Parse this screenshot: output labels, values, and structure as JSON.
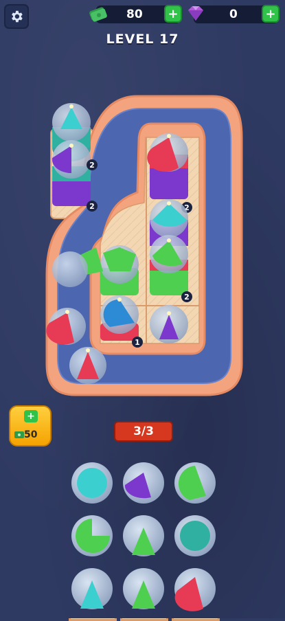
{
  "hud": {
    "cash": "80",
    "gems": "0",
    "add_symbol": "+",
    "level_label": "LEVEL 17"
  },
  "progress": {
    "label": "3/3"
  },
  "bonus": {
    "amount": "50",
    "add_symbol": "+"
  },
  "stack_counts": [
    "2",
    "2",
    "2",
    "2",
    "1"
  ],
  "colors": {
    "background": "#2f3a63",
    "track_inner": "#4d66b0",
    "track_border": "#f0a07a",
    "tray": "#f3d7b3",
    "cyan": "#3ccfd0",
    "purple": "#7c37cc",
    "red": "#e63a55",
    "green": "#4fcf4f",
    "teal": "#2fb0a0",
    "blue": "#2d8bd6"
  },
  "icons": [
    "gear-icon",
    "cash-icon",
    "gem-icon",
    "plus-icon",
    "candle-icon"
  ]
}
